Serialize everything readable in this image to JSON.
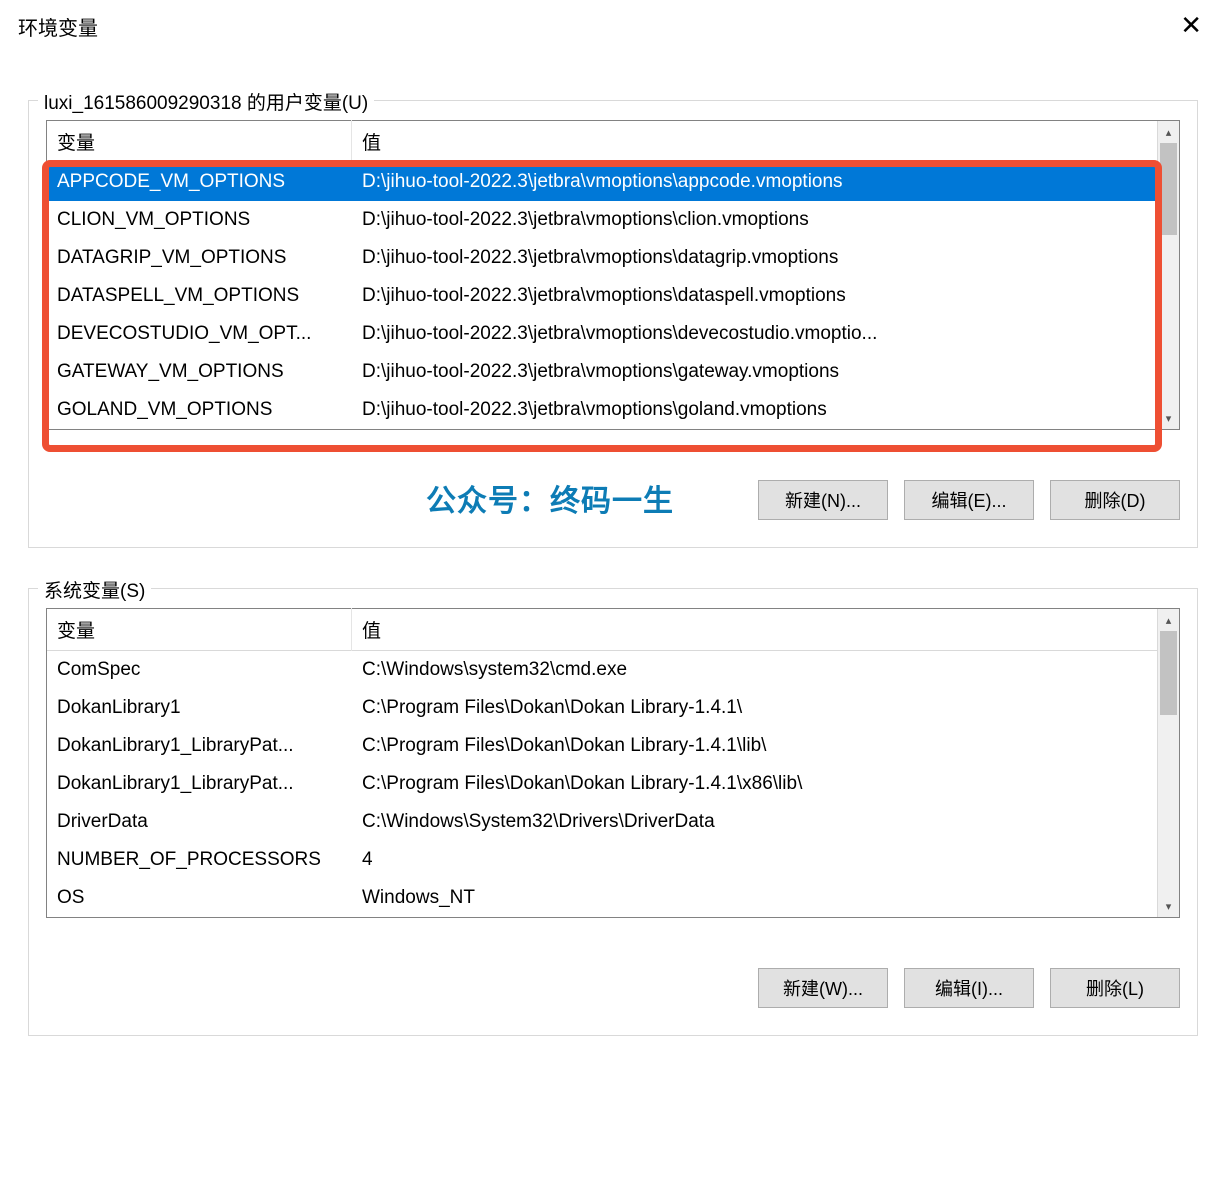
{
  "window": {
    "title": "环境变量"
  },
  "userGroup": {
    "legend": "luxi_161586009290318 的用户变量(U)",
    "headers": {
      "var": "变量",
      "val": "值"
    },
    "rows": [
      {
        "var": "APPCODE_VM_OPTIONS",
        "val": "D:\\jihuo-tool-2022.3\\jetbra\\vmoptions\\appcode.vmoptions",
        "selected": true
      },
      {
        "var": "CLION_VM_OPTIONS",
        "val": "D:\\jihuo-tool-2022.3\\jetbra\\vmoptions\\clion.vmoptions"
      },
      {
        "var": "DATAGRIP_VM_OPTIONS",
        "val": "D:\\jihuo-tool-2022.3\\jetbra\\vmoptions\\datagrip.vmoptions"
      },
      {
        "var": "DATASPELL_VM_OPTIONS",
        "val": "D:\\jihuo-tool-2022.3\\jetbra\\vmoptions\\dataspell.vmoptions"
      },
      {
        "var": "DEVECOSTUDIO_VM_OPT...",
        "val": "D:\\jihuo-tool-2022.3\\jetbra\\vmoptions\\devecostudio.vmoptio..."
      },
      {
        "var": "GATEWAY_VM_OPTIONS",
        "val": "D:\\jihuo-tool-2022.3\\jetbra\\vmoptions\\gateway.vmoptions"
      },
      {
        "var": "GOLAND_VM_OPTIONS",
        "val": "D:\\jihuo-tool-2022.3\\jetbra\\vmoptions\\goland.vmoptions"
      }
    ],
    "buttons": {
      "new": "新建(N)...",
      "edit": "编辑(E)...",
      "delete": "删除(D)"
    }
  },
  "systemGroup": {
    "legend": "系统变量(S)",
    "headers": {
      "var": "变量",
      "val": "值"
    },
    "rows": [
      {
        "var": "ComSpec",
        "val": "C:\\Windows\\system32\\cmd.exe"
      },
      {
        "var": "DokanLibrary1",
        "val": "C:\\Program Files\\Dokan\\Dokan Library-1.4.1\\"
      },
      {
        "var": "DokanLibrary1_LibraryPat...",
        "val": "C:\\Program Files\\Dokan\\Dokan Library-1.4.1\\lib\\"
      },
      {
        "var": "DokanLibrary1_LibraryPat...",
        "val": "C:\\Program Files\\Dokan\\Dokan Library-1.4.1\\x86\\lib\\"
      },
      {
        "var": "DriverData",
        "val": "C:\\Windows\\System32\\Drivers\\DriverData"
      },
      {
        "var": "NUMBER_OF_PROCESSORS",
        "val": "4"
      },
      {
        "var": "OS",
        "val": "Windows_NT"
      }
    ],
    "buttons": {
      "new": "新建(W)...",
      "edit": "编辑(I)...",
      "delete": "删除(L)"
    }
  },
  "watermark": "公众号：终码一生"
}
